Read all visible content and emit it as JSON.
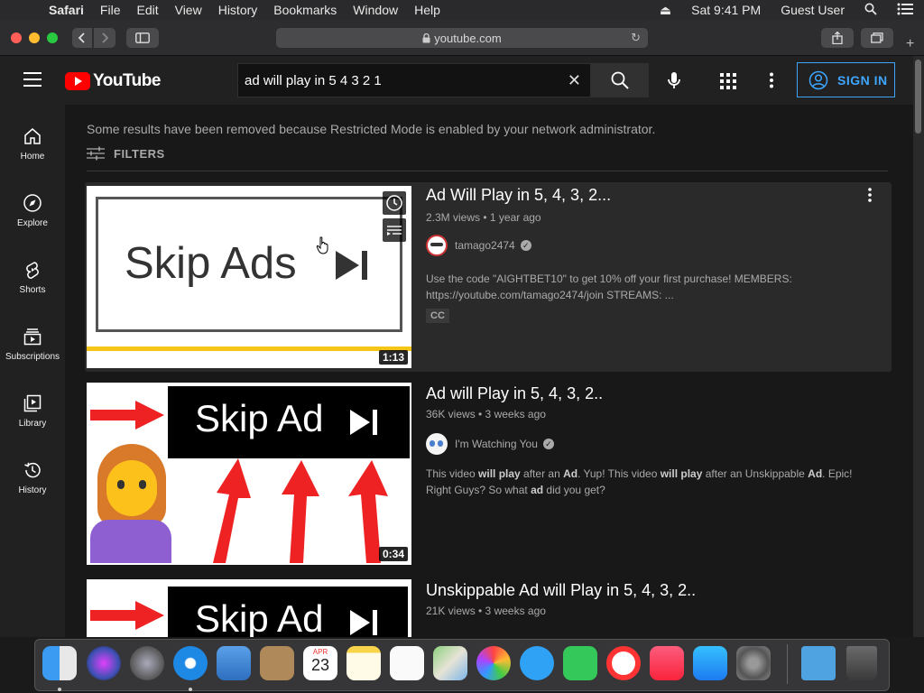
{
  "menubar": {
    "apple": "",
    "app": "Safari",
    "items": [
      "File",
      "Edit",
      "View",
      "History",
      "Bookmarks",
      "Window",
      "Help"
    ],
    "clock": "Sat 9:41 PM",
    "user": "Guest User"
  },
  "browser": {
    "url": "youtube.com"
  },
  "youtube": {
    "logo_text": "YouTube",
    "search_value": "ad will play in 5 4 3 2 1",
    "signin_label": "SIGN IN",
    "sidebar": [
      {
        "label": "Home",
        "icon": "home-icon"
      },
      {
        "label": "Explore",
        "icon": "explore-icon"
      },
      {
        "label": "Shorts",
        "icon": "shorts-icon"
      },
      {
        "label": "Subscriptions",
        "icon": "subscriptions-icon"
      },
      {
        "label": "Library",
        "icon": "library-icon"
      },
      {
        "label": "History",
        "icon": "history-icon"
      }
    ],
    "restricted_notice": "Some results have been removed because Restricted Mode is enabled by your network administrator.",
    "filters_label": "FILTERS",
    "results": [
      {
        "title": "Ad Will Play in 5, 4, 3, 2...",
        "meta": "2.3M views • 1 year ago",
        "channel": "tamago2474",
        "description": "Use the code \"AIGHTBET10\" to get 10% off your first purchase! MEMBERS: https://youtube.com/tamago2474/join STREAMS: ...",
        "badge": "CC",
        "duration": "1:13",
        "thumb_text": "Skip Ads"
      },
      {
        "title": "Ad will Play in 5, 4, 3, 2..",
        "meta": "36K views • 3 weeks ago",
        "channel": "I'm Watching You",
        "description_parts": [
          "This video ",
          "will play",
          " after an ",
          "Ad",
          ". Yup! This video ",
          "will play",
          " after an Unskippable ",
          "Ad",
          ". Epic! Right Guys? So what ",
          "ad",
          " did you get?"
        ],
        "duration": "0:34",
        "thumb_text": "Skip Ad"
      },
      {
        "title": "Unskippable Ad will Play in 5, 4, 3, 2..",
        "meta": "21K views • 3 weeks ago",
        "thumb_text": "Skip Ad"
      }
    ]
  },
  "dock": {
    "apps": [
      "Finder",
      "Siri",
      "Launchpad",
      "Safari",
      "Mail",
      "Contacts",
      "Calendar",
      "Notes",
      "Reminders",
      "Maps",
      "Photos",
      "Messages",
      "FaceTime",
      "News",
      "Music",
      "App Store",
      "System Preferences",
      "Downloads",
      "Trash"
    ],
    "calendar_month": "APR",
    "calendar_day": "23"
  }
}
